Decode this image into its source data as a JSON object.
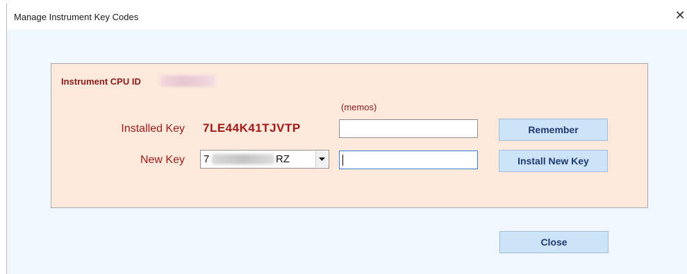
{
  "window": {
    "title": "Manage Instrument Key Codes",
    "close_glyph": "✕"
  },
  "panel": {
    "cpu_id_label": "Instrument CPU ID",
    "memos_label": "(memos)",
    "installed_key": {
      "label": "Installed Key",
      "value": "7LE44K41TJVTP",
      "memo_value": ""
    },
    "new_key": {
      "label": "New Key",
      "selected_prefix": "7",
      "selected_suffix": "RZ",
      "memo_value": ""
    }
  },
  "buttons": {
    "remember": "Remember",
    "install": "Install New Key",
    "close": "Close"
  },
  "colors": {
    "panel_bg": "#fce9dc",
    "label_red": "#9b1b1b",
    "button_bg": "#cde3f7",
    "button_text": "#1f3a73"
  }
}
